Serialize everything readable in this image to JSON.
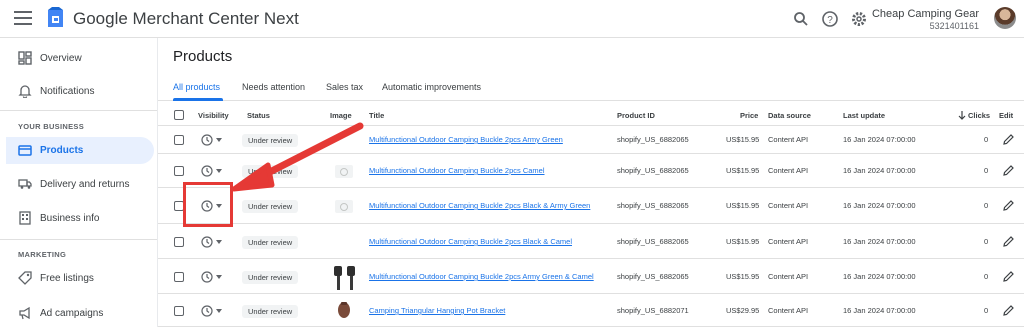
{
  "app": {
    "title": "Google Merchant Center Next",
    "account_name": "Cheap Camping Gear",
    "account_id": "5321401161"
  },
  "sidebar": {
    "items": [
      {
        "label": "Overview",
        "icon": "dashboard-icon"
      },
      {
        "label": "Notifications",
        "icon": "bell-icon"
      }
    ],
    "section_business": "YOUR BUSINESS",
    "business_items": [
      {
        "label": "Products",
        "icon": "products-icon",
        "active": true
      },
      {
        "label": "Delivery and returns",
        "icon": "truck-icon"
      },
      {
        "label": "Business info",
        "icon": "building-icon"
      }
    ],
    "section_marketing": "MARKETING",
    "marketing_items": [
      {
        "label": "Free listings",
        "icon": "tag-icon"
      },
      {
        "label": "Ad campaigns",
        "icon": "megaphone-icon"
      }
    ]
  },
  "main": {
    "page_title": "Products",
    "tabs": [
      "All products",
      "Needs attention",
      "Sales tax",
      "Automatic improvements"
    ],
    "active_tab": "All products"
  },
  "table": {
    "headers": {
      "visibility": "Visibility",
      "status": "Status",
      "image": "Image",
      "title": "Title",
      "product_id": "Product ID",
      "price": "Price",
      "data_source": "Data source",
      "last_update": "Last update",
      "clicks": "Clicks",
      "edit": "Edit"
    },
    "rows": [
      {
        "status": "Under review",
        "title": "Multifunctional Outdoor Camping Buckle 2pcs Army Green",
        "product_id": "shopify_US_6882065",
        "price": "US$15.95",
        "data_source": "Content API",
        "last_update": "16 Jan 2024 07:00:00",
        "clicks": "0",
        "image": "none"
      },
      {
        "status": "Under review",
        "title": "Multifunctional Outdoor Camping Buckle 2pcs Camel",
        "product_id": "shopify_US_6882065",
        "price": "US$15.95",
        "data_source": "Content API",
        "last_update": "16 Jan 2024 07:00:00",
        "clicks": "0",
        "image": "placeholder"
      },
      {
        "status": "Under review",
        "title": "Multifunctional Outdoor Camping Buckle 2pcs Black & Army Green",
        "product_id": "shopify_US_6882065",
        "price": "US$15.95",
        "data_source": "Content API",
        "last_update": "16 Jan 2024 07:00:00",
        "clicks": "0",
        "image": "placeholder"
      },
      {
        "status": "Under review",
        "title": "Multifunctional Outdoor Camping Buckle 2pcs Black & Camel",
        "product_id": "shopify_US_6882065",
        "price": "US$15.95",
        "data_source": "Content API",
        "last_update": "16 Jan 2024 07:00:00",
        "clicks": "0",
        "image": "none"
      },
      {
        "status": "Under review",
        "title": "Multifunctional Outdoor Camping Buckle 2pcs Army Green & Camel",
        "product_id": "shopify_US_6882065",
        "price": "US$15.95",
        "data_source": "Content API",
        "last_update": "16 Jan 2024 07:00:00",
        "clicks": "0",
        "image": "buckles"
      },
      {
        "status": "Under review",
        "title": "Camping Triangular Hanging Pot Bracket",
        "product_id": "shopify_US_6882071",
        "price": "US$29.95",
        "data_source": "Content API",
        "last_update": "16 Jan 2024 07:00:00",
        "clicks": "0",
        "image": "bracket"
      }
    ]
  },
  "colors": {
    "accent": "#1a73e8",
    "annotation": "#e53935"
  }
}
